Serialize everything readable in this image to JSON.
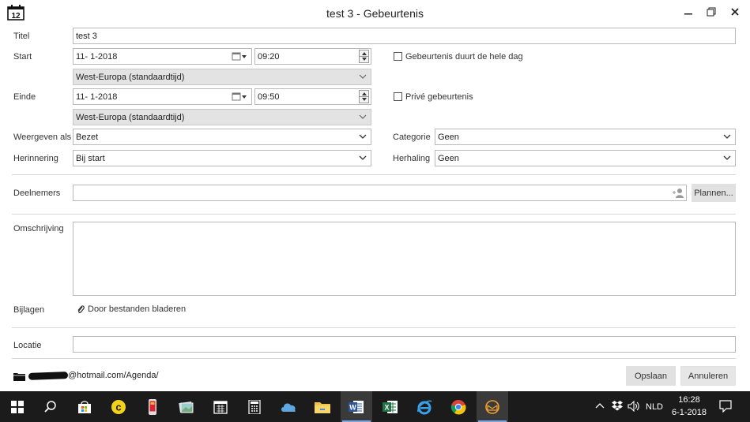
{
  "window": {
    "title": "test 3 - Gebeurtenis",
    "calendar_icon_day": "12"
  },
  "form": {
    "title_label": "Titel",
    "title_value": "test 3",
    "start_label": "Start",
    "start_date": "11- 1-2018",
    "start_time": "09:20",
    "start_timezone": "West-Europa (standaardtijd)",
    "allday_label": "Gebeurtenis duurt de hele dag",
    "end_label": "Einde",
    "end_date": "11- 1-2018",
    "end_time": "09:50",
    "end_timezone": "West-Europa (standaardtijd)",
    "private_label": "Privé gebeurtenis",
    "showas_label": "Weergeven als",
    "showas_value": "Bezet",
    "category_label": "Categorie",
    "category_value": "Geen",
    "reminder_label": "Herinnering",
    "reminder_value": "Bij start",
    "repeat_label": "Herhaling",
    "repeat_value": "Geen",
    "attendees_label": "Deelnemers",
    "attendees_value": "",
    "plan_button": "Plannen...",
    "description_label": "Omschrijving",
    "description_value": "",
    "attachments_label": "Bijlagen",
    "browse_files": "Door bestanden bladeren",
    "location_label": "Locatie",
    "location_value": ""
  },
  "footer": {
    "folder_path": "@hotmail.com/Agenda/",
    "save_button": "Opslaan",
    "cancel_button": "Annuleren"
  },
  "taskbar": {
    "language": "NLD",
    "time": "16:28",
    "date": "6-1-2018"
  },
  "colors": {
    "taskbar_bg": "#1b1b1b",
    "grey_field": "#e3e3e3",
    "active_indicator": "#7aa7e8"
  }
}
